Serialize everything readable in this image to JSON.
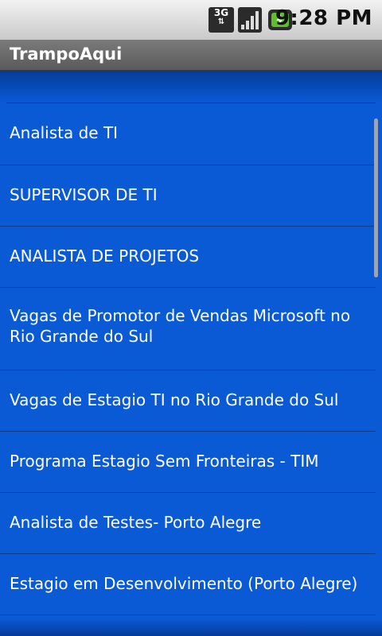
{
  "status_bar": {
    "network_icon_label": "3G",
    "time": "9:28 PM"
  },
  "app": {
    "title": "TrampoAqui"
  },
  "jobs": [
    {
      "title": "Analista de TI"
    },
    {
      "title": "SUPERVISOR DE TI"
    },
    {
      "title": "ANALISTA DE PROJETOS"
    },
    {
      "title": "Vagas de Promotor de Vendas Microsoft no Rio Grande do Sul"
    },
    {
      "title": "Vagas de Estagio TI no Rio Grande do Sul"
    },
    {
      "title": "Programa Estagio Sem Fronteiras - TIM"
    },
    {
      "title": "Analista de Testes- Porto Alegre"
    },
    {
      "title": "Estagio em Desenvolvimento (Porto Alegre)"
    }
  ],
  "colors": {
    "list_background": "#0a5ad6",
    "item_text": "#ffffff",
    "divider": "#0b2f72"
  }
}
